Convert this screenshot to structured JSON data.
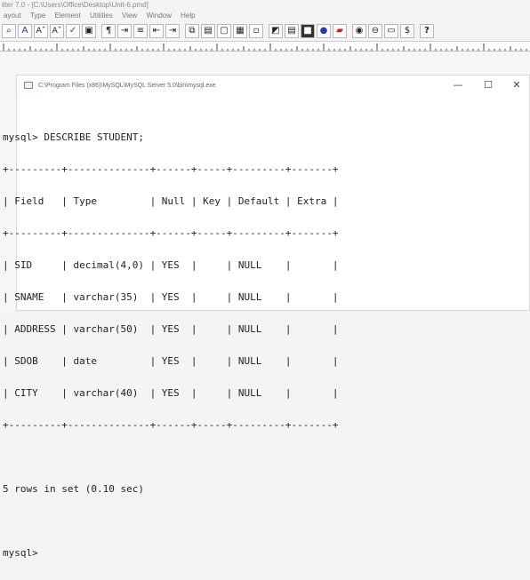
{
  "app": {
    "title": "ilter 7.0 - [C:\\Users\\Office\\Desktop\\Unit-6.pmd]",
    "menu": [
      "ayout",
      "Type",
      "Element",
      "Utilities",
      "View",
      "Window",
      "Help"
    ]
  },
  "toolbar": {
    "buttons": [
      {
        "name": "binoculars-icon",
        "glyph": "🔭"
      },
      {
        "name": "font-a-icon",
        "glyph": "A"
      },
      {
        "name": "font-size-up-icon",
        "glyph": "A"
      },
      {
        "name": "font-size-down-icon",
        "glyph": "A"
      },
      {
        "name": "spell-check-icon",
        "glyph": "✓"
      },
      {
        "name": "frame-icon",
        "glyph": "▣"
      },
      {
        "name": "paragraph-icon",
        "glyph": "¶"
      },
      {
        "name": "tab-icon",
        "glyph": "⇥"
      },
      {
        "name": "align-icon",
        "glyph": "≡"
      },
      {
        "name": "indent-icon",
        "glyph": "⇤"
      },
      {
        "name": "outdent-icon",
        "glyph": "⇥"
      },
      {
        "name": "copy-icon",
        "glyph": "⧉"
      },
      {
        "name": "paste-icon",
        "glyph": "📋"
      },
      {
        "name": "box-icon",
        "glyph": "▢"
      },
      {
        "name": "table-icon",
        "glyph": "▦"
      },
      {
        "name": "placeholder-icon",
        "glyph": "▫"
      },
      {
        "name": "image-icon",
        "glyph": "🖼"
      },
      {
        "name": "chart-icon",
        "glyph": "▤"
      },
      {
        "name": "black-square-icon",
        "glyph": "■"
      },
      {
        "name": "record-icon",
        "glyph": "●"
      },
      {
        "name": "red-book-icon",
        "glyph": "▰"
      },
      {
        "name": "circle-target-icon",
        "glyph": "◉"
      },
      {
        "name": "circle-minus-icon",
        "glyph": "⊖"
      },
      {
        "name": "screen-icon",
        "glyph": "▭"
      },
      {
        "name": "dollar-icon",
        "glyph": "$"
      },
      {
        "name": "help-icon",
        "glyph": "?"
      }
    ]
  },
  "console": {
    "title": "C:\\Program Files (x86)\\MySQL\\MySQL Server 5.0\\bin\\mysql.exe",
    "minimize": "—",
    "maximize": "☐",
    "close": "✕",
    "lines": [
      "mysql> DESCRIBE STUDENT;",
      "+---------+--------------+------+-----+---------+-------+",
      "| Field   | Type         | Null | Key | Default | Extra |",
      "+---------+--------------+------+-----+---------+-------+",
      "| SID     | decimal(4,0) | YES  |     | NULL    |       |",
      "| SNAME   | varchar(35)  | YES  |     | NULL    |       |",
      "| ADDRESS | varchar(50)  | YES  |     | NULL    |       |",
      "| SDOB    | date         | YES  |     | NULL    |       |",
      "| CITY    | varchar(40)  | YES  |     | NULL    |       |",
      "+---------+--------------+------+-----+---------+-------+",
      "5 rows in set (0.10 sec)",
      "",
      "mysql>"
    ]
  }
}
